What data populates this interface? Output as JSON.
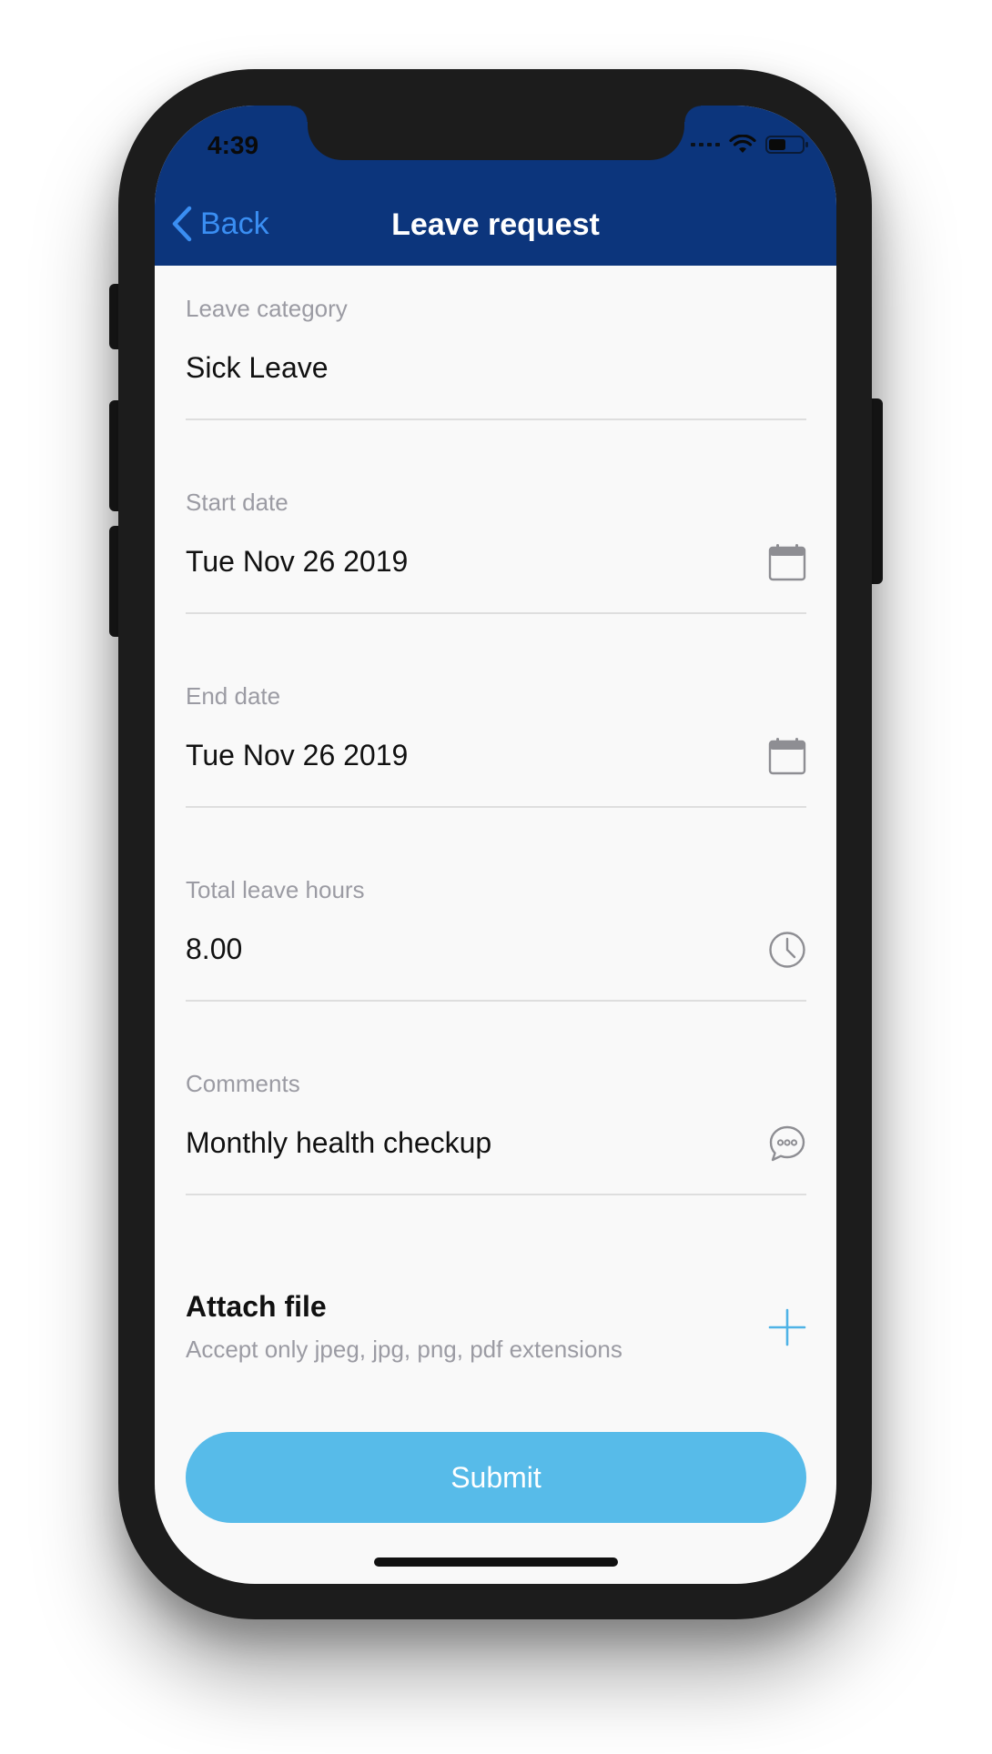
{
  "status_bar": {
    "time": "4:39"
  },
  "nav": {
    "back_label": "Back",
    "title": "Leave request"
  },
  "form": {
    "fields": [
      {
        "label": "Leave category",
        "value": "Sick Leave",
        "icon": "none"
      },
      {
        "label": "Start date",
        "value": "Tue Nov 26 2019",
        "icon": "calendar-icon"
      },
      {
        "label": "End date",
        "value": "Tue Nov 26 2019",
        "icon": "calendar-icon"
      },
      {
        "label": "Total leave hours",
        "value": "8.00",
        "icon": "clock-icon"
      },
      {
        "label": "Comments",
        "value": "Monthly health checkup",
        "icon": "comment-icon"
      }
    ],
    "attach": {
      "title": "Attach file",
      "hint": "Accept only jpeg, jpg, png, pdf extensions"
    },
    "submit_label": "Submit"
  },
  "colors": {
    "nav_bg": "#0c357c",
    "back_link": "#3a8ef2",
    "submit_bg": "#57bbe9",
    "label_gray": "#9b9ba3",
    "plus_accent": "#4fb3e6"
  }
}
